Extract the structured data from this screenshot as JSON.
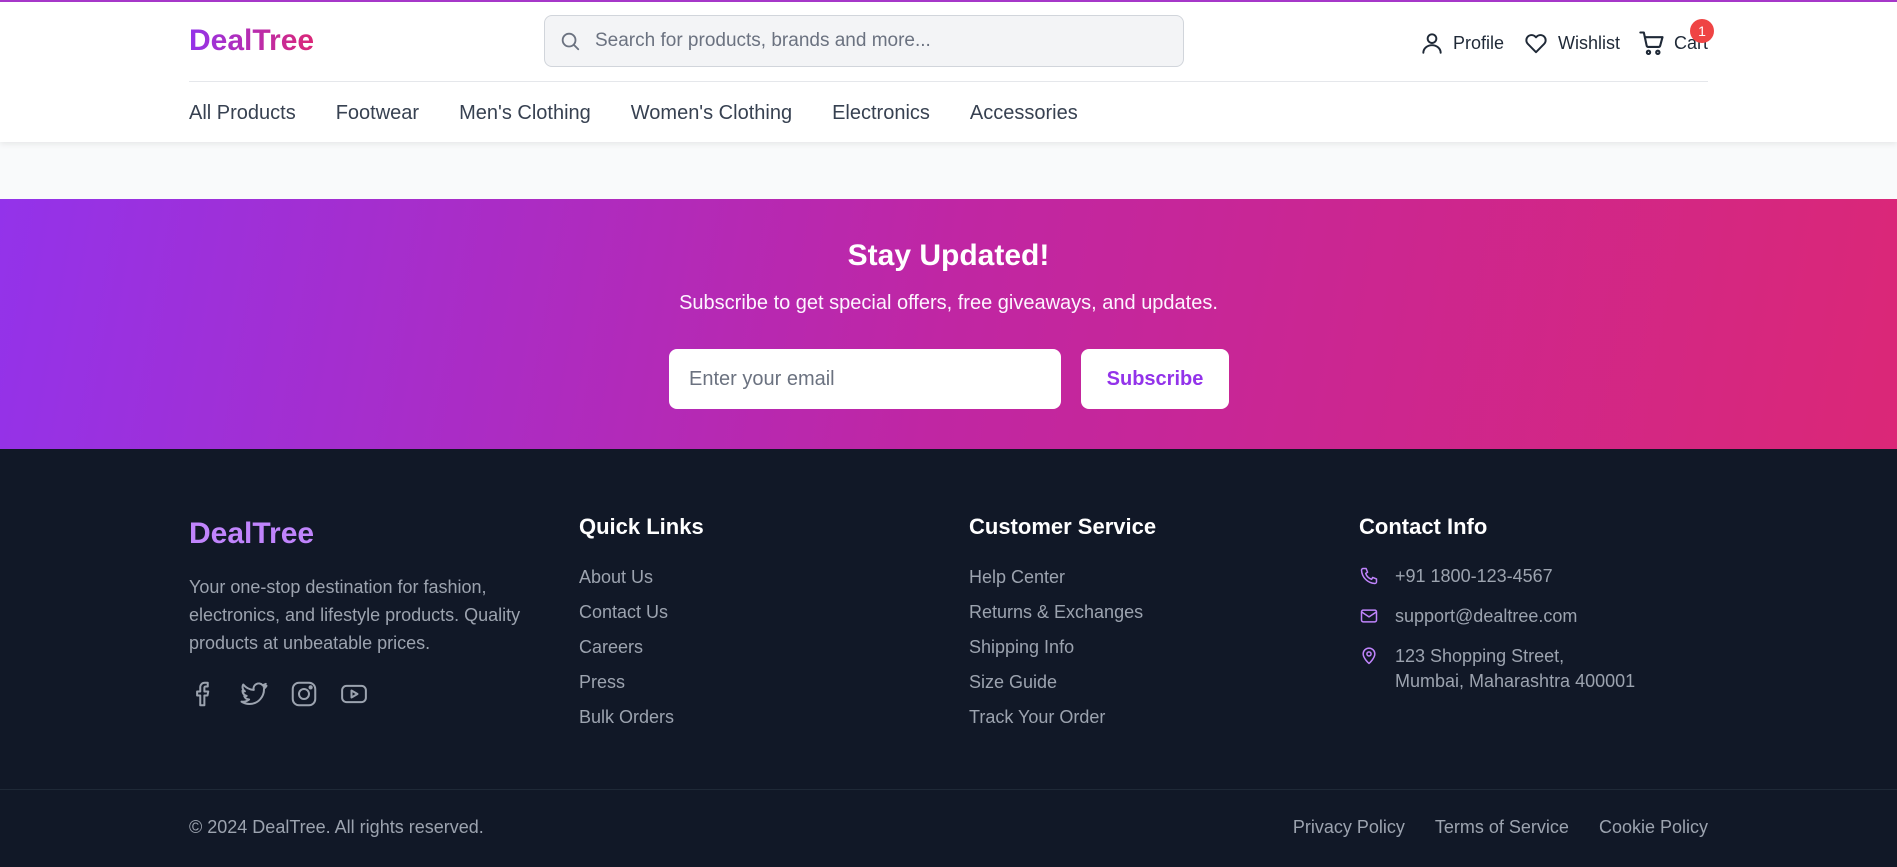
{
  "header": {
    "logo": "DealTree",
    "search_placeholder": "Search for products, brands and more...",
    "actions": {
      "profile": "Profile",
      "wishlist": "Wishlist",
      "cart": "Cart",
      "cart_count": "1"
    },
    "nav": [
      "All Products",
      "Footwear",
      "Men's Clothing",
      "Women's Clothing",
      "Electronics",
      "Accessories"
    ]
  },
  "newsletter": {
    "title": "Stay Updated!",
    "subtitle": "Subscribe to get special offers, free giveaways, and updates.",
    "email_placeholder": "Enter your email",
    "button": "Subscribe"
  },
  "footer": {
    "brand": {
      "logo": "DealTree",
      "description": "Your one-stop destination for fashion, electronics, and lifestyle products. Quality products at unbeatable prices.",
      "socials": [
        "facebook-icon",
        "twitter-icon",
        "instagram-icon",
        "youtube-icon"
      ]
    },
    "quick_links": {
      "title": "Quick Links",
      "items": [
        "About Us",
        "Contact Us",
        "Careers",
        "Press",
        "Bulk Orders"
      ]
    },
    "customer_service": {
      "title": "Customer Service",
      "items": [
        "Help Center",
        "Returns & Exchanges",
        "Shipping Info",
        "Size Guide",
        "Track Your Order"
      ]
    },
    "contact": {
      "title": "Contact Info",
      "phone": "+91 1800-123-4567",
      "email": "support@dealtree.com",
      "address_line1": "123 Shopping Street,",
      "address_line2": "Mumbai, Maharashtra 400001"
    },
    "copyright": "© 2024 DealTree. All rights reserved.",
    "legal": [
      "Privacy Policy",
      "Terms of Service",
      "Cookie Policy"
    ]
  },
  "colors": {
    "accent_purple": "#9333ea",
    "accent_pink": "#db2777",
    "footer_bg": "#111827",
    "badge_red": "#ef4444"
  }
}
